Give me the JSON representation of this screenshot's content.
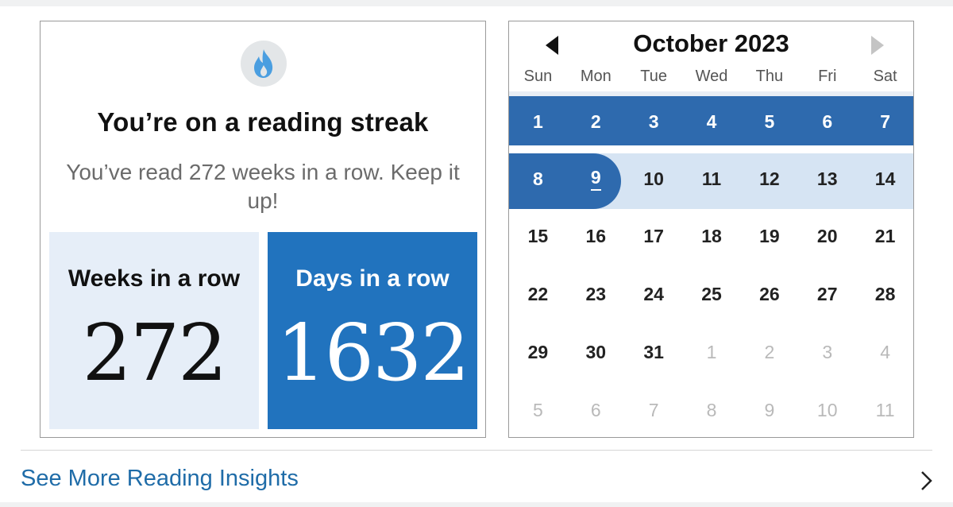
{
  "streak": {
    "title": "You’re on a reading streak",
    "message": "You’ve read 272 weeks in a row. Keep it up!",
    "weeks_label": "Weeks in a row",
    "weeks_value": "272",
    "days_label": "Days in a row",
    "days_value": "1632",
    "icon": "flame-icon",
    "icon_color": "#4a9ee0"
  },
  "calendar": {
    "month_title": "October 2023",
    "prev_icon": "triangle-left-icon",
    "next_icon": "triangle-right-icon",
    "weekdays": [
      "Sun",
      "Mon",
      "Tue",
      "Wed",
      "Thu",
      "Fri",
      "Sat"
    ],
    "weeks": [
      [
        {
          "d": "1",
          "s": "sel"
        },
        {
          "d": "2",
          "s": "sel"
        },
        {
          "d": "3",
          "s": "sel"
        },
        {
          "d": "4",
          "s": "sel"
        },
        {
          "d": "5",
          "s": "sel"
        },
        {
          "d": "6",
          "s": "sel"
        },
        {
          "d": "7",
          "s": "sel"
        }
      ],
      [
        {
          "d": "8",
          "s": "sel"
        },
        {
          "d": "9",
          "s": "today"
        },
        {
          "d": "10",
          "s": "cur"
        },
        {
          "d": "11",
          "s": "cur"
        },
        {
          "d": "12",
          "s": "cur"
        },
        {
          "d": "13",
          "s": "cur"
        },
        {
          "d": "14",
          "s": "cur"
        }
      ],
      [
        {
          "d": "15",
          "s": ""
        },
        {
          "d": "16",
          "s": ""
        },
        {
          "d": "17",
          "s": ""
        },
        {
          "d": "18",
          "s": ""
        },
        {
          "d": "19",
          "s": ""
        },
        {
          "d": "20",
          "s": ""
        },
        {
          "d": "21",
          "s": ""
        }
      ],
      [
        {
          "d": "22",
          "s": ""
        },
        {
          "d": "23",
          "s": ""
        },
        {
          "d": "24",
          "s": ""
        },
        {
          "d": "25",
          "s": ""
        },
        {
          "d": "26",
          "s": ""
        },
        {
          "d": "27",
          "s": ""
        },
        {
          "d": "28",
          "s": ""
        }
      ],
      [
        {
          "d": "29",
          "s": ""
        },
        {
          "d": "30",
          "s": ""
        },
        {
          "d": "31",
          "s": ""
        },
        {
          "d": "1",
          "s": "other"
        },
        {
          "d": "2",
          "s": "other"
        },
        {
          "d": "3",
          "s": "other"
        },
        {
          "d": "4",
          "s": "other"
        }
      ],
      [
        {
          "d": "5",
          "s": "other"
        },
        {
          "d": "6",
          "s": "other"
        },
        {
          "d": "7",
          "s": "other"
        },
        {
          "d": "8",
          "s": "other"
        },
        {
          "d": "9",
          "s": "other"
        },
        {
          "d": "10",
          "s": "other"
        },
        {
          "d": "11",
          "s": "other"
        }
      ]
    ],
    "colors": {
      "selected_week": "#2e6aae",
      "current_week": "#d6e4f3",
      "header_divider": "#e8eef5"
    }
  },
  "footer": {
    "link_label": "See More Reading Insights",
    "chevron_icon": "chevron-right-icon"
  }
}
